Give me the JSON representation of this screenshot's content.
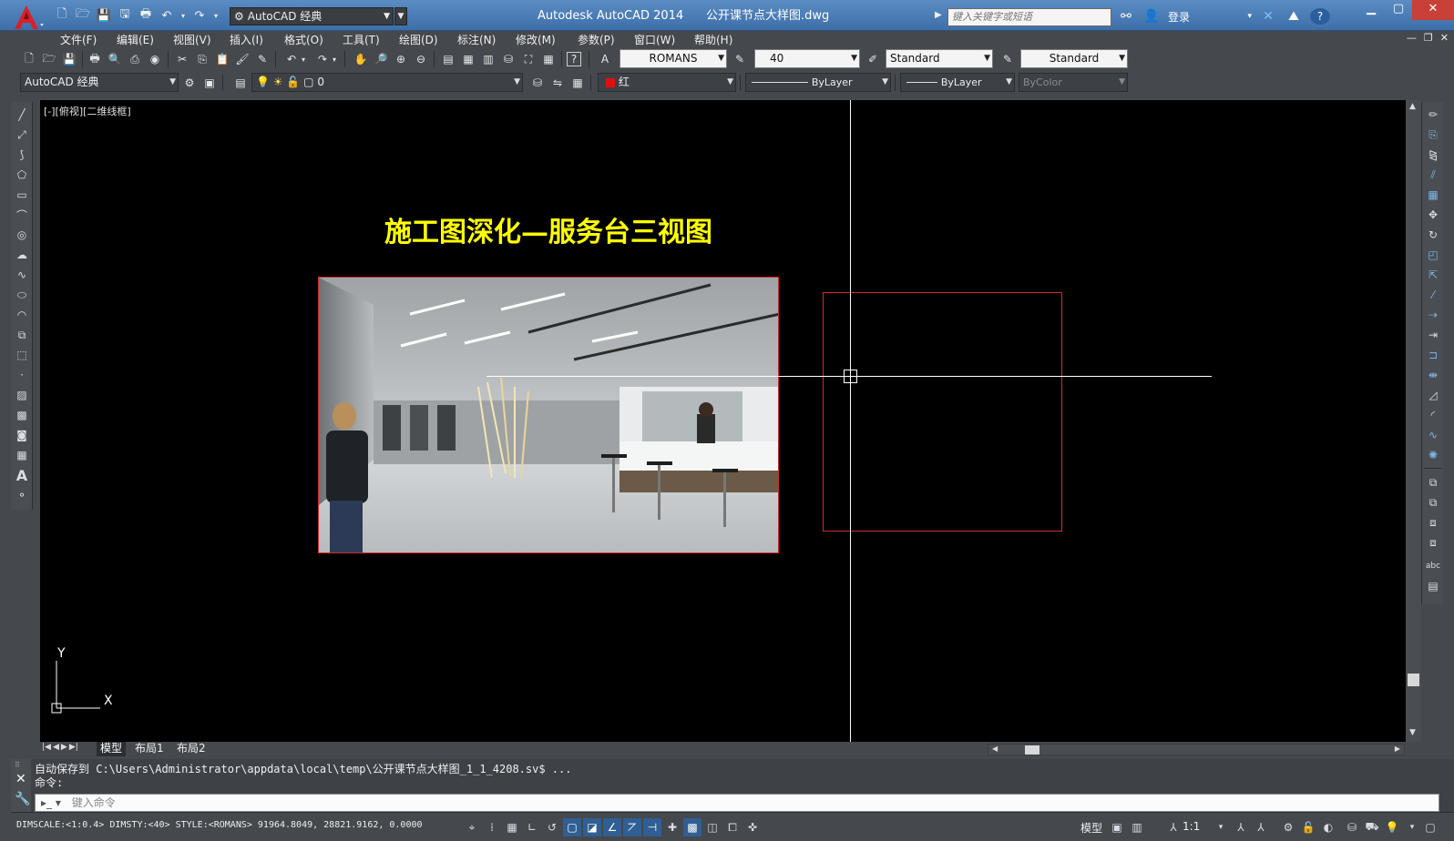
{
  "window": {
    "title": "Autodesk AutoCAD 2014      公开课节点大样图.dwg",
    "workspace": "AutoCAD 经典",
    "search_placeholder": "键入关键字或短语",
    "login": "登录"
  },
  "menu": [
    "文件(F)",
    "编辑(E)",
    "视图(V)",
    "插入(I)",
    "格式(O)",
    "工具(T)",
    "绘图(D)",
    "标注(N)",
    "修改(M)",
    "参数(P)",
    "窗口(W)",
    "帮助(H)"
  ],
  "styles": {
    "text_style": "ROMANS",
    "text_height": "40",
    "dim_style": "Standard",
    "table_style": "Standard"
  },
  "layers": {
    "workspace": "AutoCAD 经典",
    "current_layer": "0",
    "color": "红",
    "linetype": "ByLayer",
    "lineweight": "ByLayer",
    "plotstyle": "ByColor"
  },
  "viewport": {
    "label": "[-][俯视][二维线框]",
    "drawing_title": "施工图深化—服务台三视图",
    "ucs_x": "X",
    "ucs_y": "Y"
  },
  "tabs": [
    "模型",
    "布局1",
    "布局2"
  ],
  "command": {
    "history": [
      "自动保存到 C:\\Users\\Administrator\\appdata\\local\\temp\\公开课节点大样图_1_1_4208.sv$ ...",
      "命令:"
    ],
    "placeholder": "键入命令"
  },
  "status": {
    "info": "DIMSCALE:<1:0.4> DIMSTY:<40> STYLE:<ROMANS>  91964.8049, 28821.9162, 0.0000",
    "model_label": "模型",
    "scale": "1:1"
  },
  "colors": {
    "accent_red": "#d42a2a",
    "title_yellow": "#ffff00",
    "titlebar_blue": "#4a7db8"
  }
}
